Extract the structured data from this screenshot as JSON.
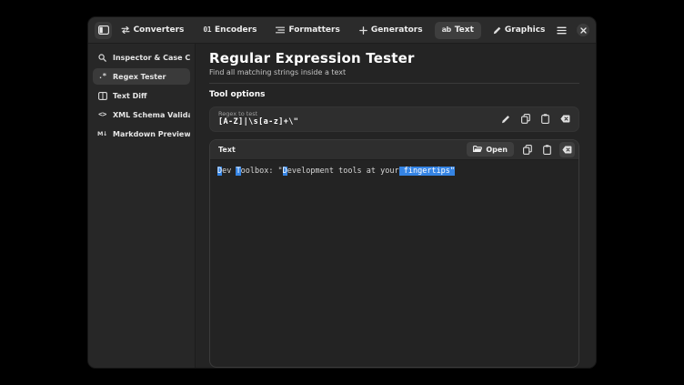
{
  "header": {
    "tabs": [
      {
        "label": "Converters",
        "icon": "swap-arrows-icon",
        "active": false
      },
      {
        "label": "Encoders",
        "icon": "binary-icon",
        "active": false
      },
      {
        "label": "Formatters",
        "icon": "indent-lines-icon",
        "active": false
      },
      {
        "label": "Generators",
        "icon": "plus-icon",
        "active": false
      },
      {
        "label": "Text",
        "icon": "ab-text-icon",
        "active": true
      },
      {
        "label": "Graphics",
        "icon": "pen-icon",
        "active": false
      }
    ],
    "tab_glyphs": {
      "encoders": "01",
      "generators": "+",
      "text": "ab"
    }
  },
  "sidebar": {
    "items": [
      {
        "label": "Inspector & Case Converter",
        "icon": "magnifier-icon",
        "selected": false
      },
      {
        "label": "Regex Tester",
        "icon": "regex-icon",
        "selected": true
      },
      {
        "label": "Text Diff",
        "icon": "diff-icon",
        "selected": false
      },
      {
        "label": "XML Schema Validator",
        "icon": "code-tags-icon",
        "selected": false
      },
      {
        "label": "Markdown Previewer",
        "icon": "markdown-icon",
        "selected": false
      }
    ],
    "item_glyphs": {
      "regex": ".*",
      "code_tags": "<>",
      "markdown": "M↓"
    }
  },
  "main": {
    "title": "Regular Expression Tester",
    "subtitle": "Find all matching strings inside a text",
    "section_label": "Tool options",
    "regex_field": {
      "label": "Regex to test",
      "value": "[A-Z]|\\s[a-z]+\\\""
    },
    "text_panel": {
      "label": "Text",
      "open_button_label": "Open",
      "content": "Dev Toolbox: \"Development tools at your fingertips\"",
      "segments": [
        {
          "text": "D",
          "highlight": true
        },
        {
          "text": "ev ",
          "highlight": false
        },
        {
          "text": "T",
          "highlight": true
        },
        {
          "text": "oolbox: \"",
          "highlight": false
        },
        {
          "text": "D",
          "highlight": true
        },
        {
          "text": "evelopment tools at your",
          "highlight": false
        },
        {
          "text": " fingertips\"",
          "highlight": true
        }
      ]
    }
  },
  "colors": {
    "accent": "#3584e4",
    "window_bg": "#242424",
    "headerbar_bg": "#2b2b2b",
    "card_bg": "#2e2e2e",
    "selected_bg": "#3a3a3a"
  }
}
